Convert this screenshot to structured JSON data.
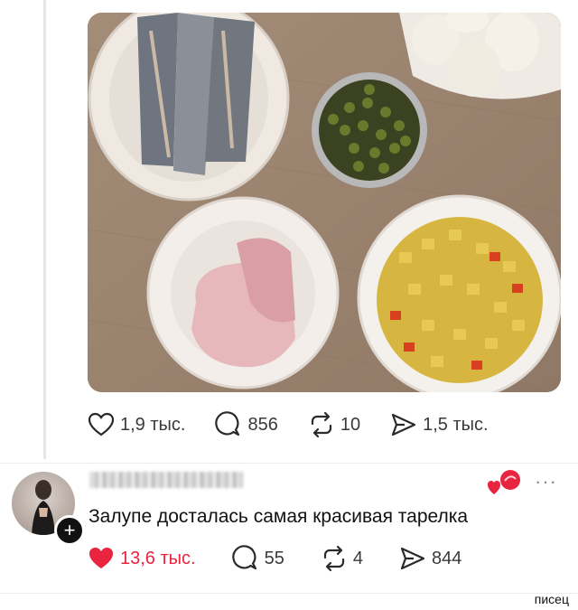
{
  "post": {
    "image_alt": "Photo of plates with herring, peas, eggs, sausage and diced vegetables",
    "stats": {
      "likes": "1,9 тыс.",
      "replies": "856",
      "reposts": "10",
      "shares": "1,5 тыс."
    }
  },
  "reply": {
    "text": "Залупе досталась самая красивая тарелка",
    "follow_label": "+",
    "more_label": "···",
    "stats": {
      "likes": "13,6 тыс.",
      "replies": "55",
      "reposts": "4",
      "shares": "844"
    }
  },
  "watermark": "писец",
  "colors": {
    "like_active": "#e8243f",
    "text_secondary": "#3a3a3a",
    "icon": "#2a2a2a",
    "table_wood": "#9d8671"
  },
  "icons": [
    "heart-icon",
    "comment-icon",
    "repost-icon",
    "share-icon",
    "plus-icon",
    "more-icon"
  ]
}
